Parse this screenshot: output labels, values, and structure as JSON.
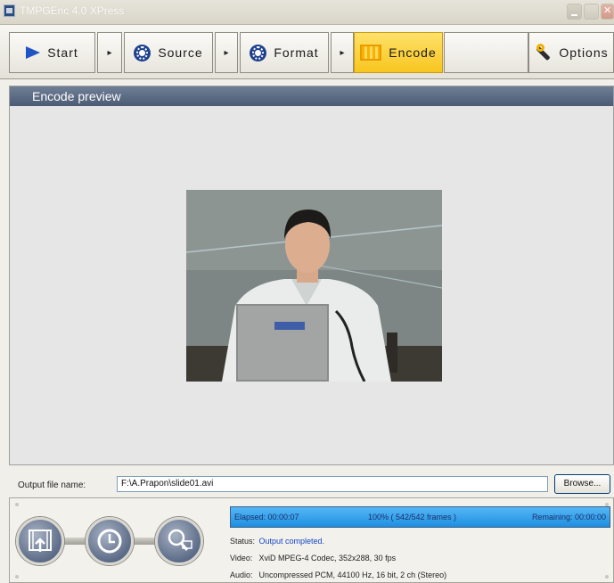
{
  "window": {
    "title": "TMPGEnc 4.0 XPress"
  },
  "toolbar": {
    "start_label": "Start",
    "source_label": "Source",
    "format_label": "Format",
    "encode_label": "Encode",
    "options_label": "Options",
    "step_arrow": "▸",
    "active_step": "Encode",
    "active_color": "#f7c51e"
  },
  "preview": {
    "title": "Encode preview"
  },
  "output": {
    "label": "Output file name:",
    "value": "F:\\A.Prapon\\slide01.avi",
    "browse_label": "Browse..."
  },
  "progress": {
    "elapsed": "Elapsed: 00:00:07",
    "percent_text": "100% ( 542/542  frames )",
    "remaining": "Remaining: 00:00:00",
    "fraction": 1.0
  },
  "info": {
    "status_key": "Status:",
    "status_value": "Output completed.",
    "video_key": "Video:",
    "video_value": "XviD MPEG-4 Codec, 352x288, 30 fps",
    "audio_key": "Audio:",
    "audio_value": "Uncompressed PCM, 44100 Hz, 16 bit, 2 ch (Stereo)"
  },
  "controls": {
    "icons": [
      "output-to-file-icon",
      "timer-icon",
      "preview-zoom-icon"
    ]
  }
}
